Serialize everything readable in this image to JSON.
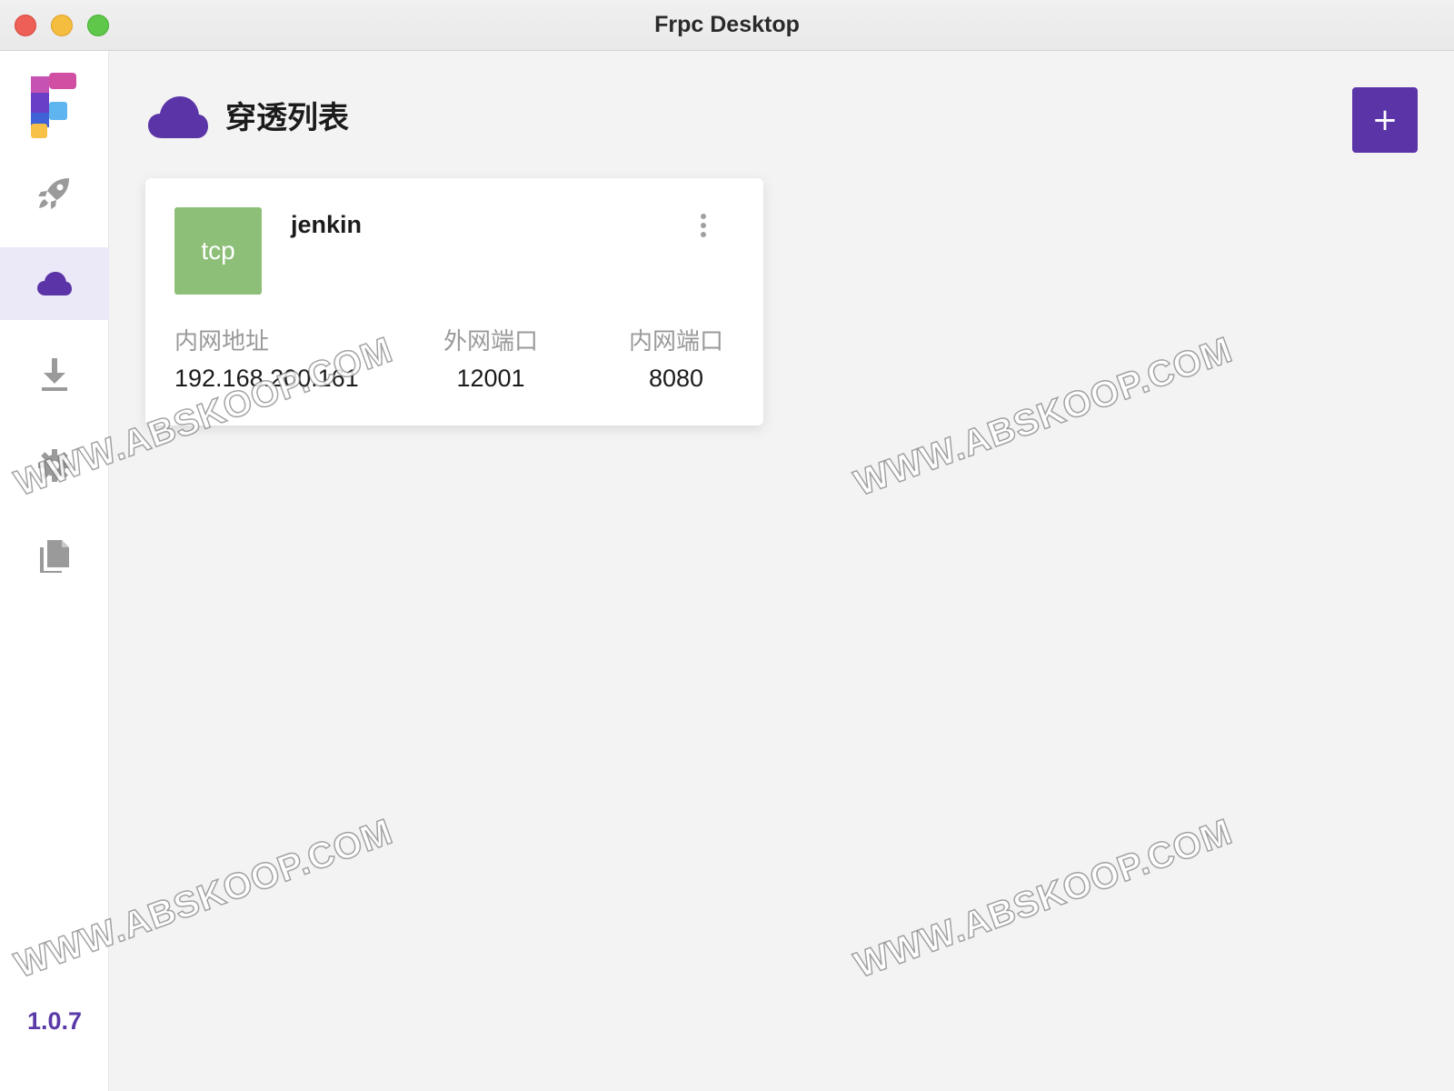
{
  "window": {
    "title": "Frpc Desktop"
  },
  "sidebar": {
    "items": [
      {
        "name": "launch",
        "icon": "rocket-icon",
        "active": false
      },
      {
        "name": "proxy-list",
        "icon": "cloud-icon",
        "active": true
      },
      {
        "name": "download",
        "icon": "download-icon",
        "active": false
      },
      {
        "name": "settings",
        "icon": "gear-icon",
        "active": false
      },
      {
        "name": "logs",
        "icon": "document-icon",
        "active": false
      }
    ],
    "version": "1.0.7"
  },
  "main": {
    "title": "穿透列表",
    "title_icon": "cloud-icon",
    "add_button_label": "+",
    "proxies": [
      {
        "type": "tcp",
        "name": "jenkin",
        "fields": {
          "local_ip_label": "内网地址",
          "local_ip": "192.168.200.161",
          "remote_port_label": "外网端口",
          "remote_port": "12001",
          "local_port_label": "内网端口",
          "local_port": "8080"
        }
      }
    ]
  },
  "watermark": "WWW.ABSKOOP.COM",
  "colors": {
    "accent": "#5b35a8",
    "active_nav_bg": "#ebe8f7",
    "tcp_badge": "#8dbf78",
    "label_gray": "#9a9a9a"
  }
}
